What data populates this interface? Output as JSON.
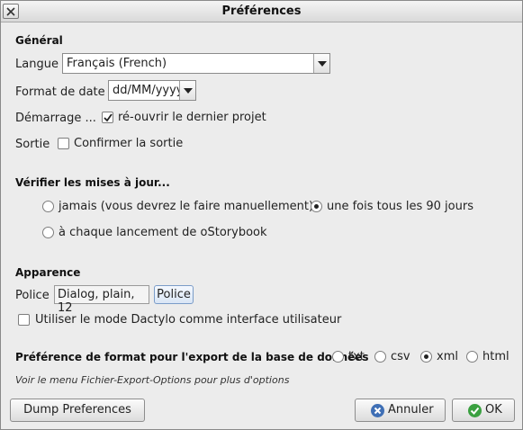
{
  "window": {
    "title": "Préférences"
  },
  "general": {
    "heading": "Général",
    "language_label": "Langue",
    "language_value": "Français (French)",
    "date_label": "Format de date",
    "date_value": "dd/MM/yyyy",
    "startup_label": "Démarrage ...",
    "reopen_label": "ré-ouvrir le dernier projet",
    "reopen_checked": true,
    "exit_label": "Sortie",
    "confirm_exit_label": "Confirmer la sortie",
    "confirm_exit_checked": false
  },
  "updates": {
    "heading": "Vérifier les mises à jour...",
    "options": [
      "jamais (vous devrez le faire manuellement)",
      "une fois tous les 90 jours",
      "à chaque lancement de oStorybook"
    ],
    "selected": "une fois tous les 90 jours"
  },
  "appearance": {
    "heading": "Apparence",
    "font_label": "Police",
    "font_value": "Dialog, plain, 12",
    "font_button": "Police",
    "typing_mode_label": "Utiliser le mode Dactylo comme interface utilisateur",
    "typing_mode_checked": false
  },
  "export": {
    "label": "Préférence de format pour l'export de la base de données",
    "formats": [
      "txt",
      "csv",
      "xml",
      "html"
    ],
    "selected": "xml",
    "note": "Voir le menu Fichier-Export-Options pour plus d'options"
  },
  "footer": {
    "dump_button": "Dump Preferences",
    "cancel_button": "Annuler",
    "ok_button": "OK"
  },
  "colors": {
    "cancel_icon": "#3f6fb5",
    "ok_icon": "#3aa040"
  }
}
